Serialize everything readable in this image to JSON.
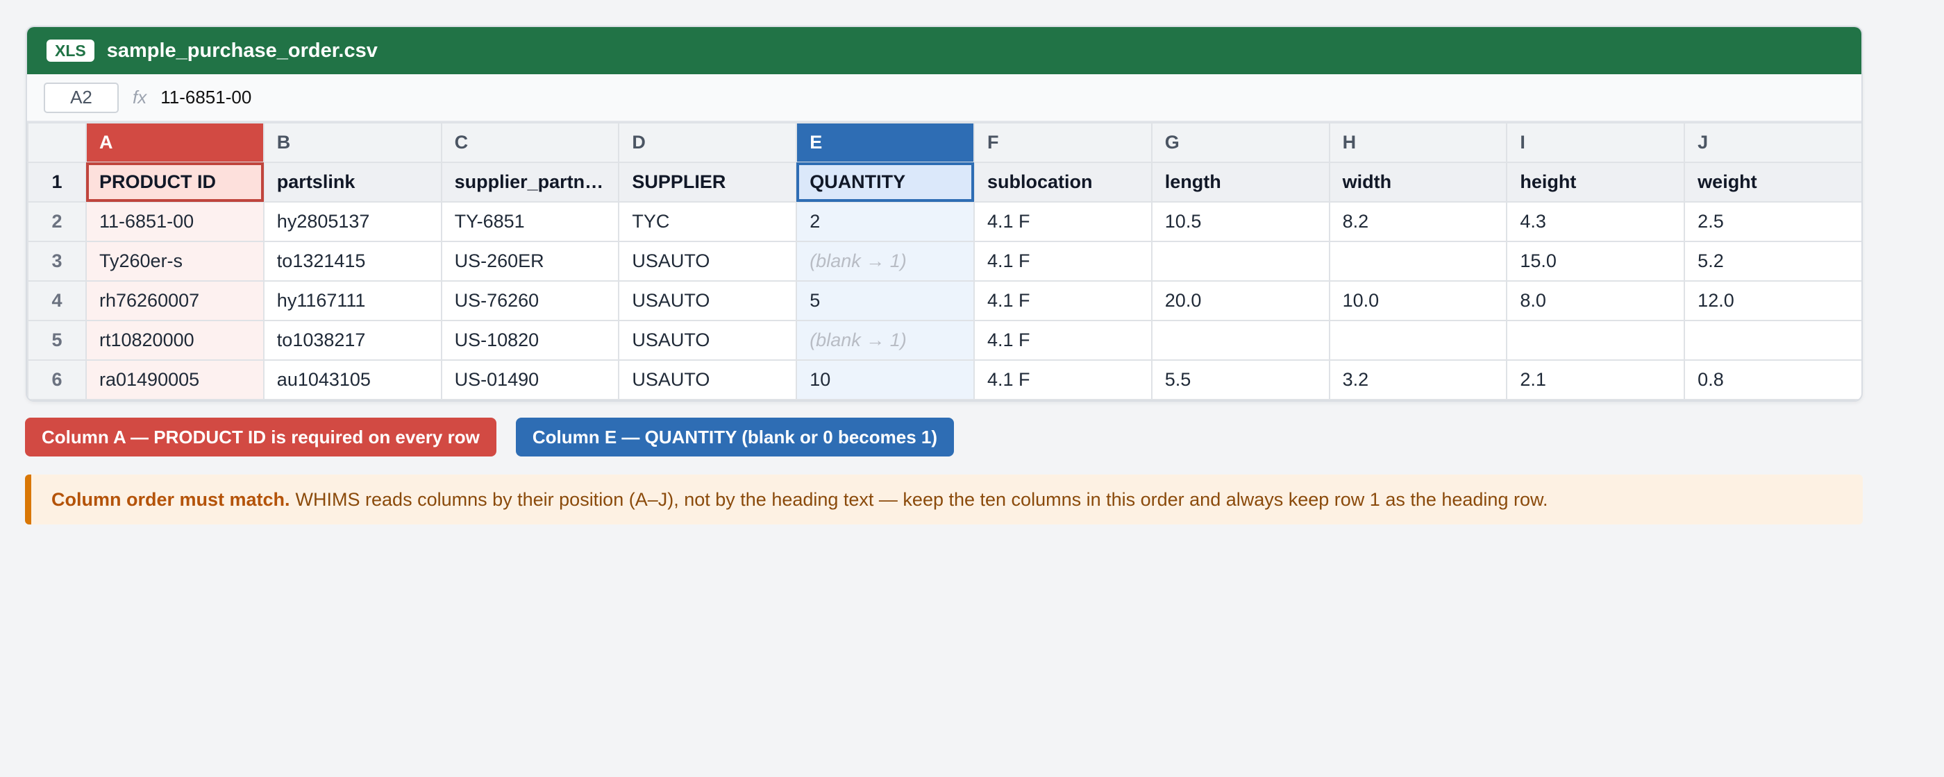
{
  "window": {
    "badge": "XLS",
    "filename": "sample_purchase_order.csv",
    "name_box": "A2",
    "fx_label": "fx",
    "formula_value": "11-6851-00"
  },
  "colors": {
    "titlebar": "#217346",
    "required_accent": "#d24a43",
    "quantity_accent": "#2e6db4",
    "notice_accent": "#d97706"
  },
  "columns": [
    "A",
    "B",
    "C",
    "D",
    "E",
    "F",
    "G",
    "H",
    "I",
    "J"
  ],
  "header_row": {
    "num": "1",
    "cells": [
      "PRODUCT ID",
      "partslink",
      "supplier_partn…",
      "SUPPLIER",
      "QUANTITY",
      "sublocation",
      "length",
      "width",
      "height",
      "weight"
    ]
  },
  "rows": [
    {
      "num": "2",
      "cells": [
        "11-6851-00",
        "hy2805137",
        "TY-6851",
        "TYC",
        "2",
        "4.1 F",
        "10.5",
        "8.2",
        "4.3",
        "2.5"
      ]
    },
    {
      "num": "3",
      "cells": [
        "Ty260er-s",
        "to1321415",
        "US-260ER",
        "USAUTO",
        "(blank → 1)",
        "4.1 F",
        "",
        "",
        "15.0",
        "5.2"
      ]
    },
    {
      "num": "4",
      "cells": [
        "rh76260007",
        "hy1167111",
        "US-76260",
        "USAUTO",
        "5",
        "4.1 F",
        "20.0",
        "10.0",
        "8.0",
        "12.0"
      ]
    },
    {
      "num": "5",
      "cells": [
        "rt10820000",
        "to1038217",
        "US-10820",
        "USAUTO",
        "(blank → 1)",
        "4.1 F",
        "",
        "",
        "",
        ""
      ]
    },
    {
      "num": "6",
      "cells": [
        "ra01490005",
        "au1043105",
        "US-01490",
        "USAUTO",
        "10",
        "4.1 F",
        "5.5",
        "3.2",
        "2.1",
        "0.8"
      ]
    }
  ],
  "pills": {
    "required": "Column A — PRODUCT ID is required on every row",
    "quantity": "Column E — QUANTITY (blank or 0 becomes 1)"
  },
  "notice": {
    "bold": "Column order must match.",
    "text": "WHIMS reads columns by their position (A–J), not by the heading text — keep the ten columns in this order and always keep row 1 as the heading row."
  }
}
